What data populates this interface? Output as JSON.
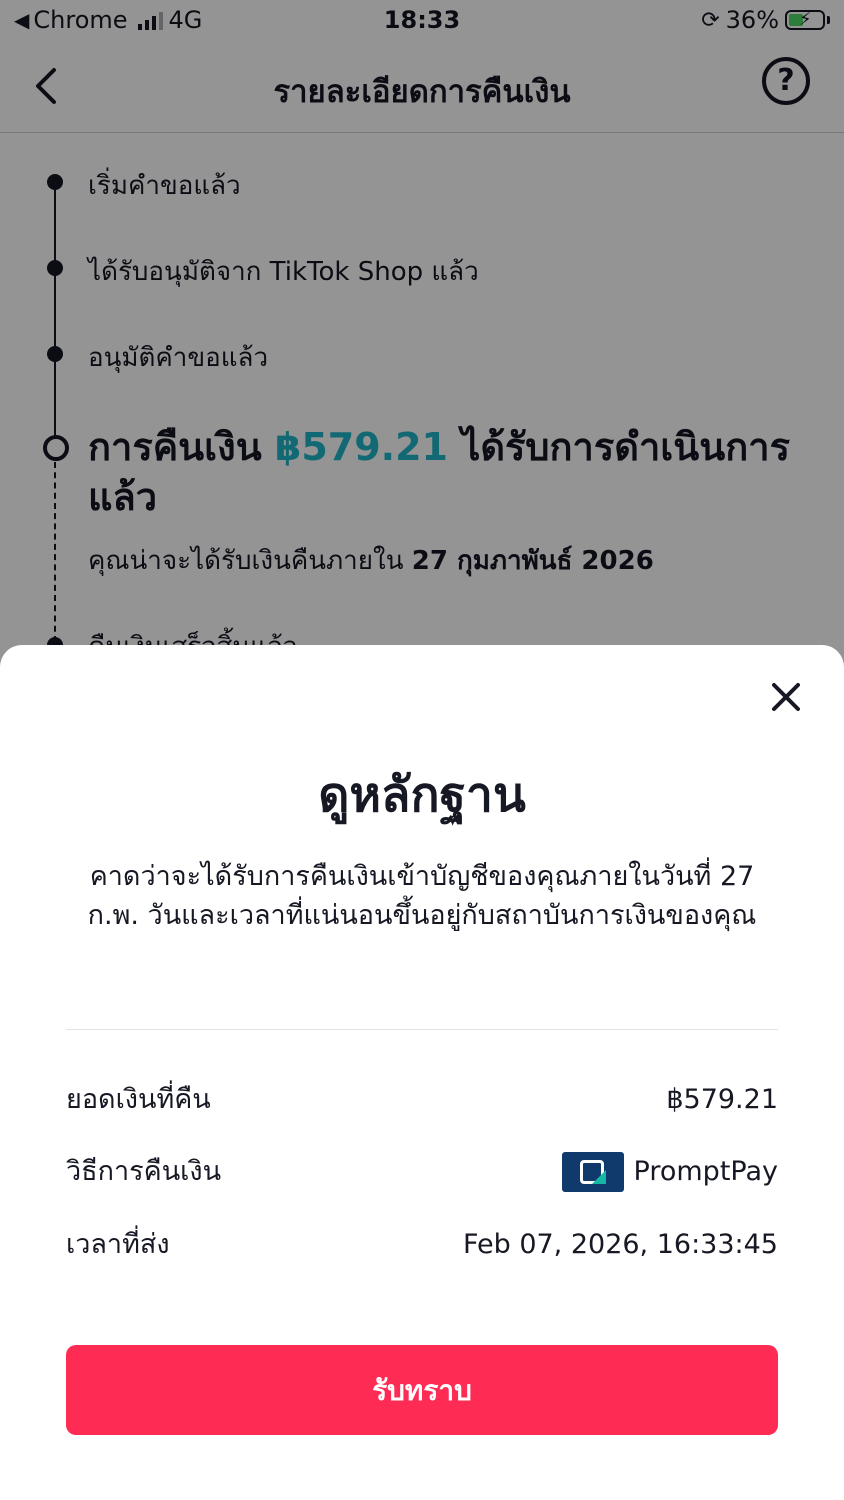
{
  "status_bar": {
    "carrier": "Chrome",
    "network": "4G",
    "time": "18:33",
    "battery": "36%"
  },
  "header": {
    "title": "รายละเอียดการคืนเงิน",
    "back_icon": "chevron-left-icon",
    "help_icon": "question-circle-icon"
  },
  "timeline": {
    "steps": [
      {
        "label": "เริ่มคำขอแล้ว"
      },
      {
        "label": "ได้รับอนุมัติจาก TikTok Shop แล้ว"
      },
      {
        "label": "อนุมัติคำขอแล้ว"
      }
    ],
    "current": {
      "prefix": "การคืนเงิน",
      "amount": "฿579.21",
      "suffix_line1": "ได้รับการดำเนินการ",
      "suffix_line2": "แล้ว",
      "expected_prefix": "คุณน่าจะได้รับเงินคืนภายใน",
      "expected_date": "27 กุมภาพันธ์ 2026"
    },
    "next_step": "คืนเงินเสร็จสิ้นแล้ว"
  },
  "sheet": {
    "title": "ดูหลักฐาน",
    "description": "คาดว่าจะได้รับการคืนเงินเข้าบัญชีของคุณภายในวันที่ 27 ก.พ. วันและเวลาที่แน่นอนขึ้นอยู่กับสถาบันการเงินของคุณ",
    "rows": [
      {
        "label": "ยอดเงินที่คืน",
        "value": "฿579.21"
      },
      {
        "label": "วิธีการคืนเงิน",
        "value": "PromptPay"
      },
      {
        "label": "เวลาที่ส่ง",
        "value": "Feb 07, 2026, 16:33:45"
      }
    ],
    "ack_button": "รับทราบ",
    "close_icon": "close-icon",
    "method_icon": "promptpay-logo-icon"
  },
  "colors": {
    "accent": "#fe2c55",
    "amount": "#20b6c7",
    "promptpay": "#0f3a6b"
  }
}
